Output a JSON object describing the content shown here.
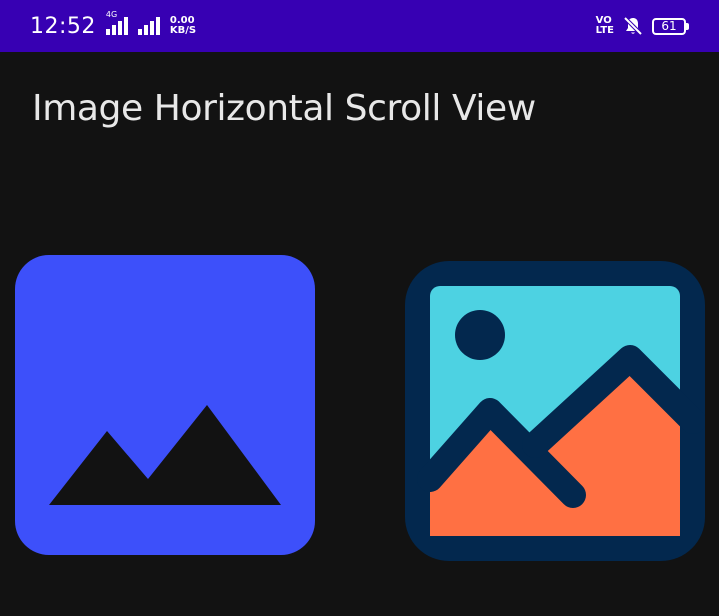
{
  "status_bar": {
    "time": "12:52",
    "network_tag": "4G",
    "data_speed_value": "0.00",
    "data_speed_unit": "KB/S",
    "volte_top": "VO",
    "volte_bottom": "LTE",
    "battery_level": "61",
    "background_color": "#3700B3"
  },
  "app": {
    "title": "Image Horizontal Scroll View",
    "background_color": "#121212"
  },
  "scroll_view": {
    "images": [
      {
        "name": "image-placeholder-icon",
        "background_color": "#3D50FA",
        "foreground_color": "#121212"
      },
      {
        "name": "landscape-picture-icon",
        "frame_color": "#03284E",
        "sky_color": "#4DD2E2",
        "mountain_color": "#FF7043"
      }
    ]
  }
}
